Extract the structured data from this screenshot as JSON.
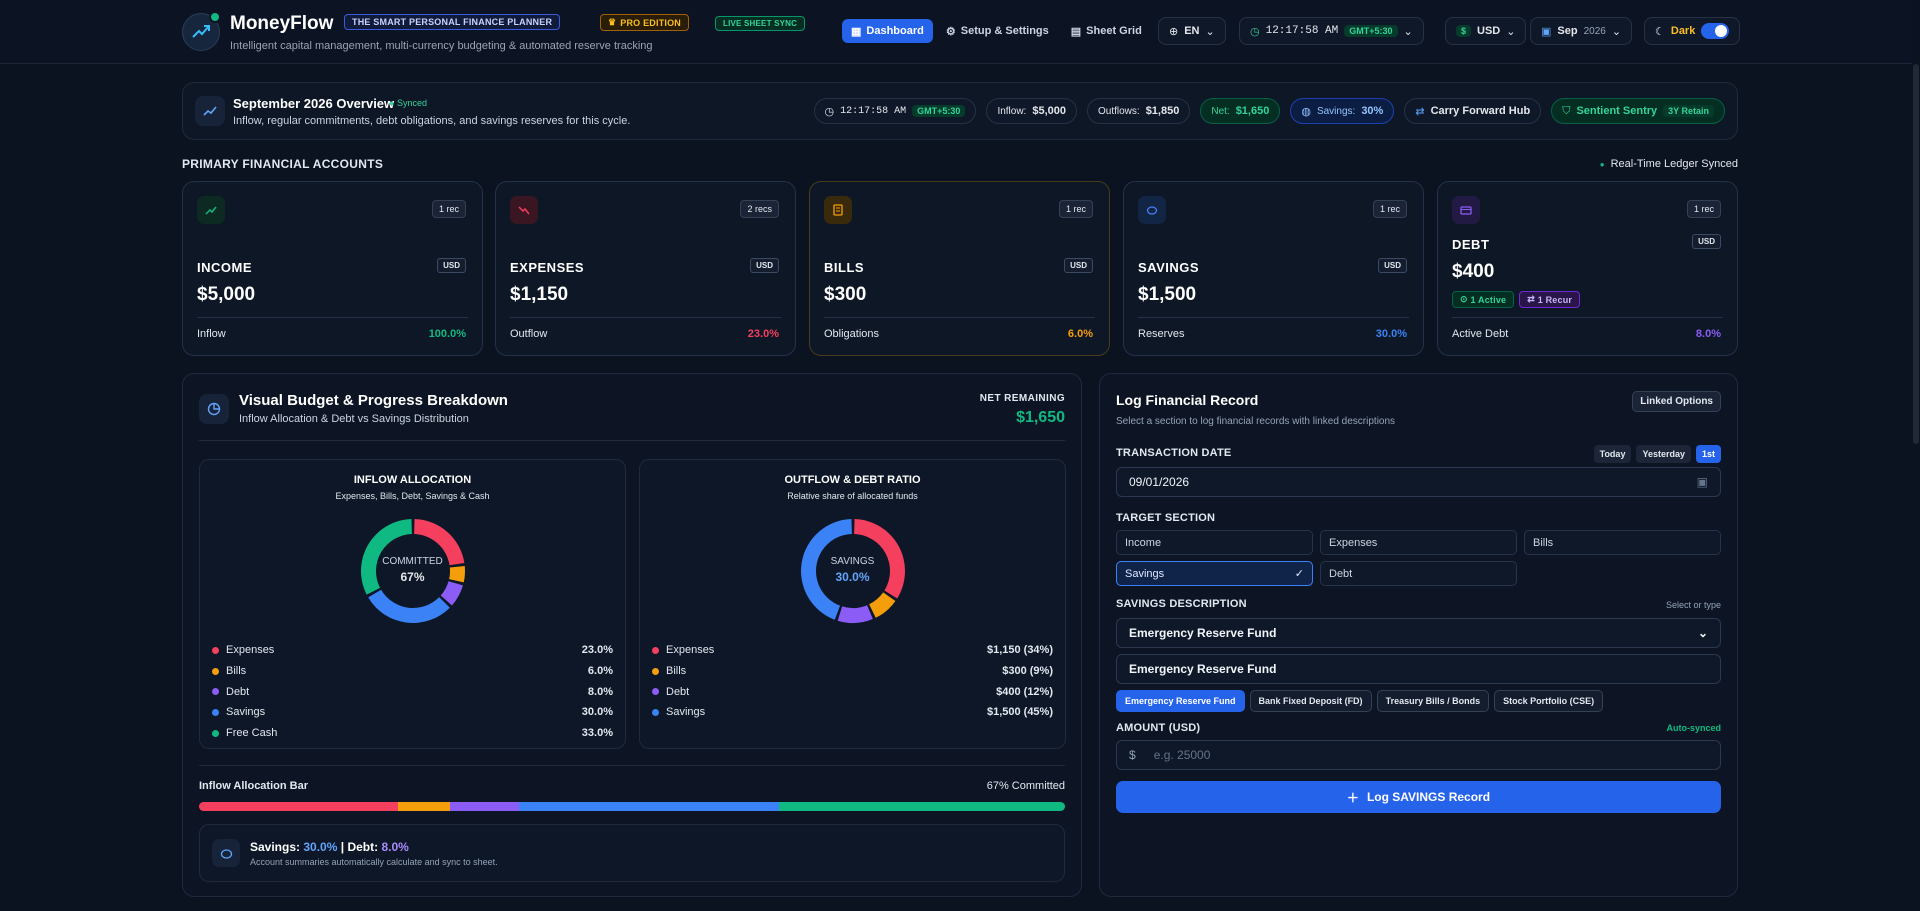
{
  "header": {
    "brand": "MoneyFlow",
    "subtitle": "Intelligent capital management, multi-currency budgeting & automated reserve tracking",
    "tag_planner": "THE SMART PERSONAL FINANCE PLANNER",
    "tag_pro": "PRO EDITION",
    "tag_sync": "LIVE SHEET SYNC",
    "nav": [
      "Dashboard",
      "Setup & Settings",
      "Sheet Grid"
    ],
    "language": "EN",
    "time": "12:17:58 AM",
    "tz": "GMT+5:30",
    "currency": "USD",
    "currency_symbol": "$",
    "month": "Sep",
    "year": "2026",
    "theme": "Dark"
  },
  "overview": {
    "title": "September 2026 Overview",
    "synced": "Synced",
    "subtitle": "Inflow, regular commitments, debt obligations, and savings reserves for this cycle.",
    "time": "12:17:58 AM",
    "tz": "GMT+5:30",
    "inflow_label": "Inflow:",
    "inflow": "$5,000",
    "outflows_label": "Outflows:",
    "outflows": "$1,850",
    "net_label": "Net:",
    "net": "$1,650",
    "savings_label": "Savings:",
    "savings": "30%",
    "carry": "Carry Forward Hub",
    "sentry": "Sentient Sentry",
    "retain": "3Y Retain"
  },
  "accounts": {
    "title": "PRIMARY FINANCIAL ACCOUNTS",
    "sync": "Real-Time Ledger Synced",
    "cards": [
      {
        "name": "INCOME",
        "recs": "1 rec",
        "cur": "USD",
        "amount": "$5,000",
        "footer": "Inflow",
        "pct": "100.0%",
        "color": "#10b981"
      },
      {
        "name": "EXPENSES",
        "recs": "2 recs",
        "cur": "USD",
        "amount": "$1,150",
        "footer": "Outflow",
        "pct": "23.0%",
        "color": "#f43f5e"
      },
      {
        "name": "BILLS",
        "recs": "1 rec",
        "cur": "USD",
        "amount": "$300",
        "footer": "Obligations",
        "pct": "6.0%",
        "color": "#f59e0b"
      },
      {
        "name": "SAVINGS",
        "recs": "1 rec",
        "cur": "USD",
        "amount": "$1,500",
        "footer": "Reserves",
        "pct": "30.0%",
        "color": "#3b82f6"
      },
      {
        "name": "DEBT",
        "recs": "1 rec",
        "cur": "USD",
        "amount": "$400",
        "footer": "Active Debt",
        "pct": "8.0%",
        "color": "#8b5cf6",
        "active": "1 Active",
        "recur": "1 Recur"
      }
    ]
  },
  "budget": {
    "title": "Visual Budget & Progress Breakdown",
    "subtitle": "Inflow Allocation & Debt vs Savings Distribution",
    "net_label": "NET REMAINING",
    "net_value": "$1,650",
    "inflow": {
      "title": "INFLOW ALLOCATION",
      "subtitle": "Expenses, Bills, Debt, Savings & Cash",
      "center_label": "COMMITTED",
      "center_value": "67%",
      "legend": [
        {
          "label": "Expenses",
          "value": "23.0%",
          "color": "#f43f5e"
        },
        {
          "label": "Bills",
          "value": "6.0%",
          "color": "#f59e0b"
        },
        {
          "label": "Debt",
          "value": "8.0%",
          "color": "#8b5cf6"
        },
        {
          "label": "Savings",
          "value": "30.0%",
          "color": "#3b82f6"
        },
        {
          "label": "Free Cash",
          "value": "33.0%",
          "color": "#10b981"
        }
      ]
    },
    "outflow": {
      "title": "OUTFLOW & DEBT RATIO",
      "subtitle": "Relative share of allocated funds",
      "center_label": "SAVINGS",
      "center_value": "30.0%",
      "legend": [
        {
          "label": "Expenses",
          "value": "$1,150 (34%)",
          "color": "#f43f5e"
        },
        {
          "label": "Bills",
          "value": "$300 (9%)",
          "color": "#f59e0b"
        },
        {
          "label": "Debt",
          "value": "$400 (12%)",
          "color": "#8b5cf6"
        },
        {
          "label": "Savings",
          "value": "$1,500 (45%)",
          "color": "#3b82f6"
        }
      ]
    },
    "bar_label": "Inflow Allocation Bar",
    "bar_committed": "67% Committed",
    "note_savings_label": "Savings:",
    "note_savings": "30.0%",
    "note_sep": "|",
    "note_debt_label": "Debt:",
    "note_debt": "8.0%",
    "note_text": "Account summaries automatically calculate and sync to sheet."
  },
  "chart_data": [
    {
      "type": "pie",
      "title": "INFLOW ALLOCATION",
      "categories": [
        "Expenses",
        "Bills",
        "Debt",
        "Savings",
        "Free Cash"
      ],
      "values": [
        23.0,
        6.0,
        8.0,
        30.0,
        33.0
      ],
      "colors": [
        "#f43f5e",
        "#f59e0b",
        "#8b5cf6",
        "#3b82f6",
        "#10b981"
      ]
    },
    {
      "type": "pie",
      "title": "OUTFLOW & DEBT RATIO",
      "categories": [
        "Expenses",
        "Bills",
        "Debt",
        "Savings"
      ],
      "values": [
        1150,
        300,
        400,
        1500
      ],
      "colors": [
        "#f43f5e",
        "#f59e0b",
        "#8b5cf6",
        "#3b82f6"
      ]
    }
  ],
  "log": {
    "title": "Log Financial Record",
    "subtitle": "Select a section to log financial records with linked descriptions",
    "linked": "Linked Options",
    "date_label": "TRANSACTION DATE",
    "quick": [
      "Today",
      "Yesterday",
      "1st"
    ],
    "date_value": "09/01/2026",
    "section_label": "TARGET SECTION",
    "sections": [
      "Income",
      "Expenses",
      "Bills",
      "Savings",
      "Debt"
    ],
    "desc_label": "SAVINGS DESCRIPTION",
    "desc_hint": "Select or type",
    "desc_select": "Emergency Reserve Fund",
    "desc_input": "Emergency Reserve Fund",
    "chips": [
      "Emergency Reserve Fund",
      "Bank Fixed Deposit (FD)",
      "Treasury Bills / Bonds",
      "Stock Portfolio (CSE)"
    ],
    "amount_label": "AMOUNT (USD)",
    "auto": "Auto-synced",
    "amount_prefix": "$",
    "amount_placeholder": "e.g. 25000",
    "button": "Log SAVINGS Record"
  }
}
